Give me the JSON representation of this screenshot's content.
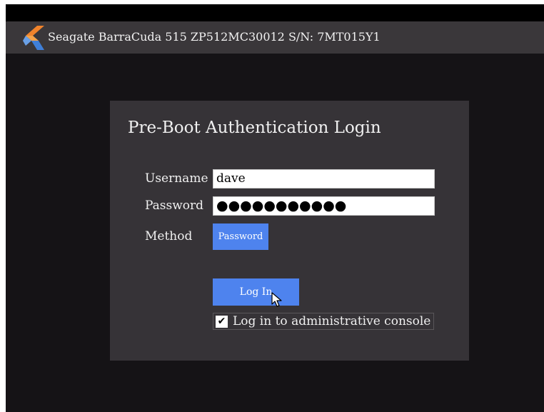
{
  "header": {
    "title": "Seagate BarraCuda 515 ZP512MC30012 S/N: 7MT015Y1",
    "logo_icon": "seagate-logo-icon"
  },
  "login_panel": {
    "title": "Pre-Boot Authentication Login",
    "username_label": "Username",
    "username_value": "dave",
    "password_label": "Password",
    "password_value": "●●●●●●●●●●●",
    "method_label": "Method",
    "method_button": "Password",
    "login_button": "Log In",
    "admin_console_label": "Log in to administrative console",
    "admin_console_checked": "✔"
  },
  "colors": {
    "accent": "#4e83ee",
    "panel": "#363337",
    "titlebar": "#3a373a",
    "background": "#151316"
  }
}
